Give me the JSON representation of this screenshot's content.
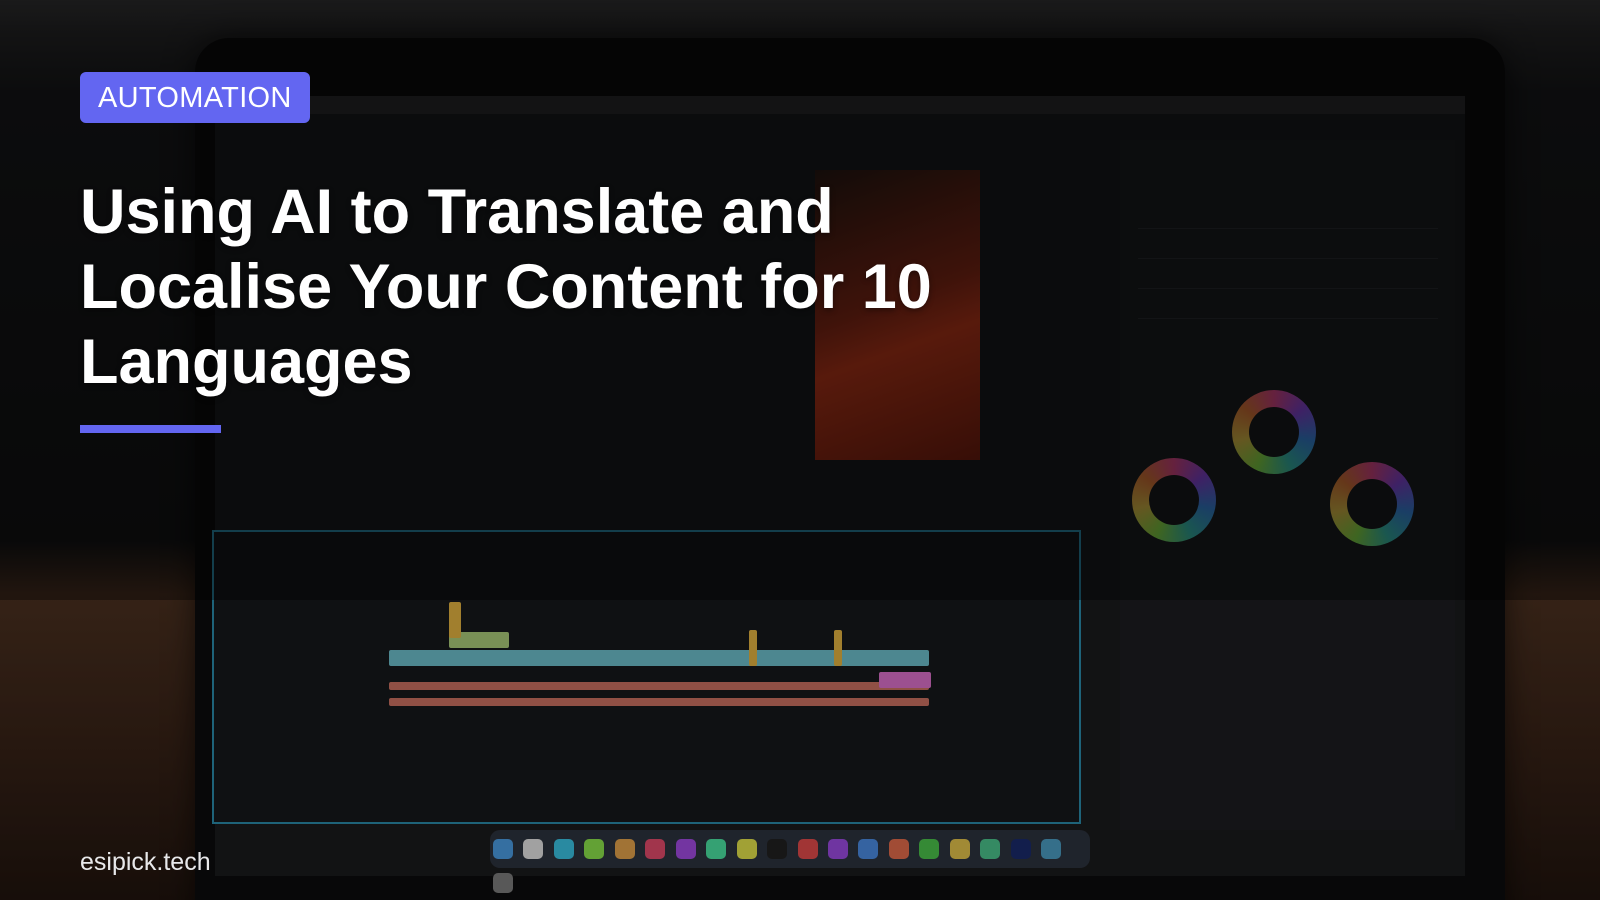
{
  "article": {
    "category": "AUTOMATION",
    "title": "Using AI to Translate and Localise Your Content for 10 Languages",
    "site": "esipick.tech"
  },
  "colors": {
    "accent": "#6366f1",
    "title_text": "#ffffff"
  },
  "background": {
    "description_icon": "laptop-video-editor-photo"
  }
}
